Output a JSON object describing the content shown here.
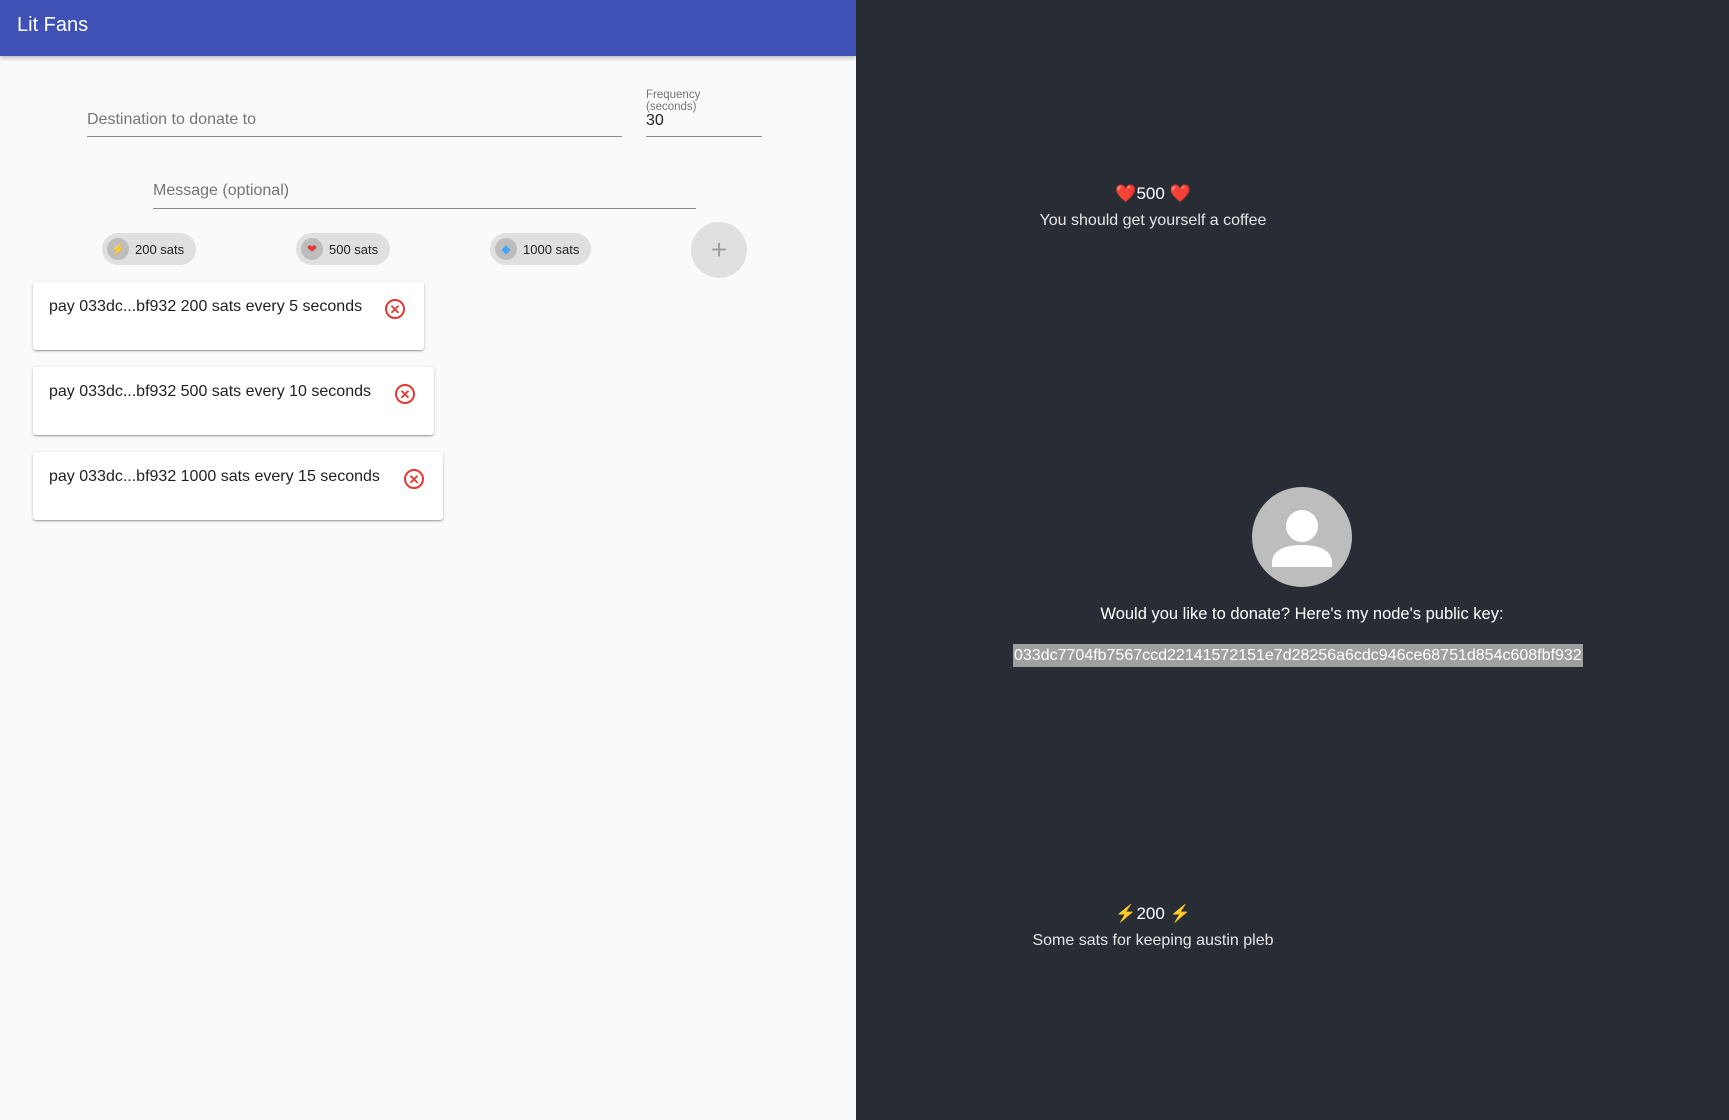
{
  "app": {
    "title": "Lit Fans"
  },
  "form": {
    "destination_placeholder": "Destination to donate to",
    "frequency_label": "Frequency (seconds)",
    "frequency_value": "30",
    "message_placeholder": "Message (optional)"
  },
  "chips": [
    {
      "icon": "lightning-icon",
      "glyph": "⚡",
      "label": "200 sats"
    },
    {
      "icon": "heart-icon",
      "glyph": "❤",
      "label": "500 sats"
    },
    {
      "icon": "gem-icon",
      "glyph": "◆",
      "label": "1000 sats"
    }
  ],
  "add_button": {
    "glyph": "+"
  },
  "payments": [
    {
      "text": "pay 033dc...bf932 200 sats every 5 seconds",
      "remove_glyph": "✕"
    },
    {
      "text": "pay 033dc...bf932 500 sats every 10 seconds",
      "remove_glyph": "✕"
    },
    {
      "text": "pay 033dc...bf932 1000 sats every 15 seconds",
      "remove_glyph": "✕"
    }
  ],
  "stream": {
    "top_donation": {
      "emoji": "❤️",
      "amount": "500",
      "message": "You should get yourself a coffee"
    },
    "bottom_donation": {
      "emoji": "⚡",
      "amount": "200",
      "message": "Some sats for keeping austin pleb"
    },
    "question": "Would you like to donate? Here's my node's public key:",
    "public_key": "033dc7704fb7567ccd22141572151e7d28256a6cdc946ce68751d854c608fbf932"
  },
  "colors": {
    "app_bar": "#3f51b5",
    "dark_bg": "#282c34",
    "remove": "#e53935"
  }
}
